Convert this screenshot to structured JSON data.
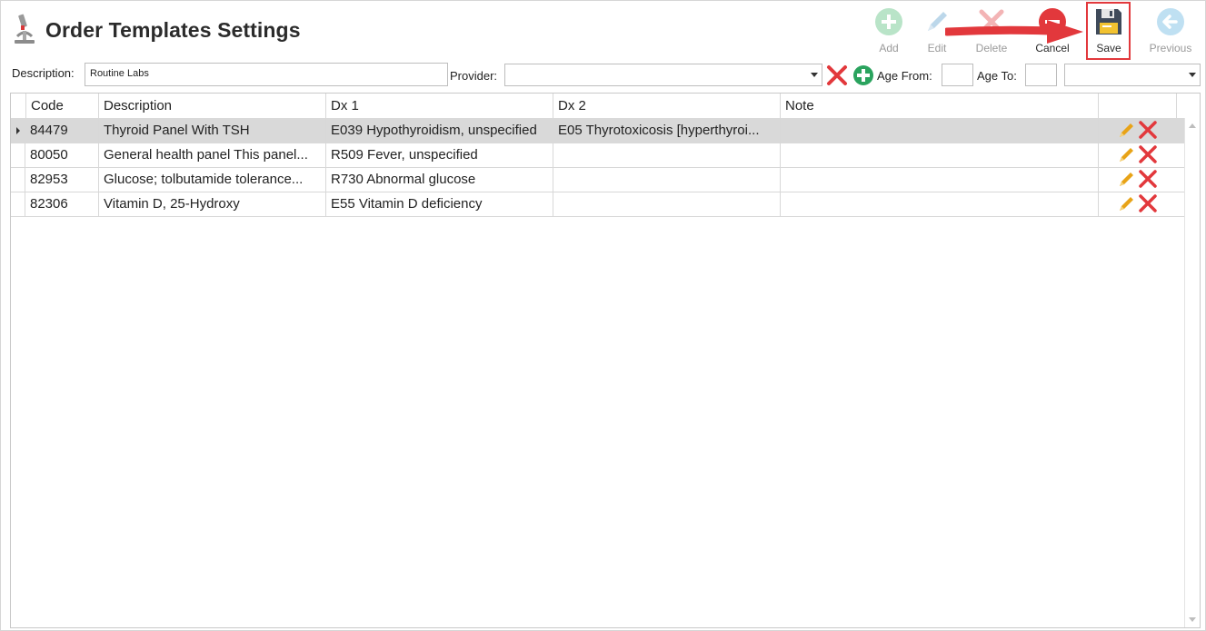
{
  "page": {
    "title": "Order Templates Settings"
  },
  "toolbar": {
    "add_label": "Add",
    "edit_label": "Edit",
    "delete_label": "Delete",
    "cancel_label": "Cancel",
    "save_label": "Save",
    "previous_label": "Previous"
  },
  "filters": {
    "description_label": "Description:",
    "description_value": "Routine Labs",
    "provider_label": "Provider:",
    "provider_value": "",
    "age_from_label": "Age From:",
    "age_from_value": "",
    "age_to_label": "Age To:",
    "age_to_value": "",
    "age_unit_value": ""
  },
  "grid": {
    "columns": [
      "Code",
      "Description",
      "Dx 1",
      "Dx 2",
      "Note"
    ],
    "rows": [
      {
        "code": "84479",
        "description": "Thyroid Panel With TSH",
        "dx1": "E039 Hypothyroidism, unspecified",
        "dx2": "E05 Thyrotoxicosis [hyperthyroi...",
        "note": "",
        "selected": true
      },
      {
        "code": "80050",
        "description": "General health panel This panel...",
        "dx1": "R509 Fever, unspecified",
        "dx2": "",
        "note": ""
      },
      {
        "code": "82953",
        "description": "Glucose; tolbutamide tolerance...",
        "dx1": "R730 Abnormal glucose",
        "dx2": "",
        "note": ""
      },
      {
        "code": "82306",
        "description": "Vitamin D, 25-Hydroxy",
        "dx1": "E55 Vitamin D deficiency",
        "dx2": "",
        "note": ""
      }
    ]
  },
  "icons": {
    "title": "microscope-icon",
    "add": "plus-circle-icon",
    "edit": "pencil-icon",
    "delete": "x-icon",
    "cancel": "minus-circle-icon",
    "save": "floppy-disk-icon",
    "previous": "arrow-left-circle-icon",
    "clear": "red-x-icon",
    "add_provider": "green-plus-circle-icon"
  },
  "colors": {
    "accent_red": "#e2383c",
    "add_green": "#2aa35e",
    "selected_row": "#d9d9d9",
    "edit_pencil": "#e8a317"
  }
}
